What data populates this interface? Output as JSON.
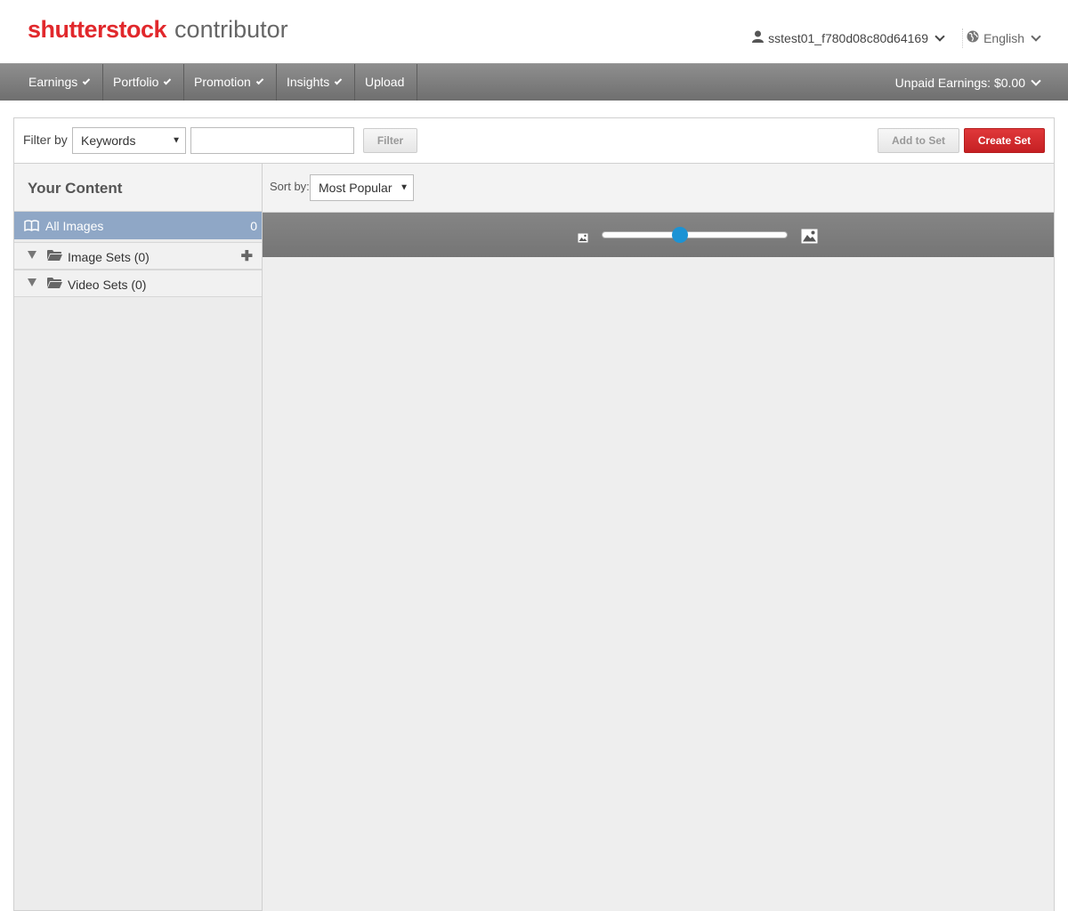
{
  "header": {
    "logo_brand": "shutterstock",
    "logo_sub": "contributor",
    "username": "sstest01_f780d08c80d64169",
    "language": "English"
  },
  "nav": {
    "items": [
      {
        "label": "Earnings",
        "has_dropdown": true
      },
      {
        "label": "Portfolio",
        "has_dropdown": true
      },
      {
        "label": "Promotion",
        "has_dropdown": true
      },
      {
        "label": "Insights",
        "has_dropdown": true
      },
      {
        "label": "Upload",
        "has_dropdown": false
      }
    ],
    "unpaid_earnings": "Unpaid Earnings: $0.00"
  },
  "filter": {
    "label": "Filter by",
    "field_selected": "Keywords",
    "query_value": "",
    "filter_button": "Filter",
    "add_to_set_button": "Add to Set",
    "create_set_button": "Create Set"
  },
  "sidebar": {
    "title": "Your Content",
    "all_images_label": "All Images",
    "all_images_count": "0",
    "sets": [
      {
        "label": "Image Sets (0)",
        "can_add": true
      },
      {
        "label": "Video Sets (0)",
        "can_add": false
      }
    ]
  },
  "main": {
    "sort_label": "Sort by:",
    "sort_selected": "Most Popular",
    "thumbnail_size_level": 0.42
  },
  "colors": {
    "brand_red": "#e1282c",
    "nav_bg": "#7d7d7d",
    "selected_row": "#8fa7c6",
    "slider_knob": "#1c93d4"
  }
}
